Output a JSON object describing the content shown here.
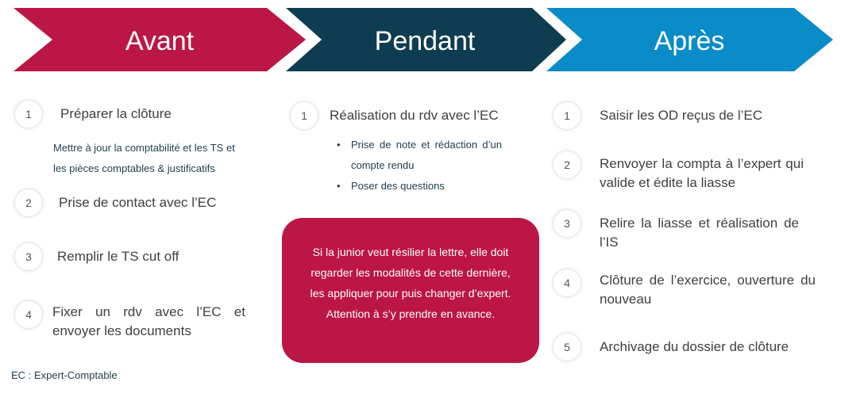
{
  "phases": [
    {
      "title": "Avant",
      "color": "#bb1645",
      "steps": [
        {
          "num": "1",
          "text": "Préparer la clôture",
          "detail_lines": [
            "Mettre à jour la comptabilité et les TS et",
            "les pièces comptables & justificatifs"
          ]
        },
        {
          "num": "2",
          "text": "Prise de contact avec l’EC"
        },
        {
          "num": "3",
          "text": "Remplir le TS cut off"
        },
        {
          "num": "4",
          "text": "Fixer un rdv avec l’EC et envoyer les documents"
        }
      ]
    },
    {
      "title": "Pendant",
      "color": "#0e3d52",
      "steps": [
        {
          "num": "1",
          "text": "Réalisation du rdv avec l’EC",
          "bullets": [
            "Prise de note et rédaction d’un compte rendu",
            "Poser des questions"
          ]
        }
      ],
      "note": "Si la junior veut résilier la lettre, elle doit regarder les modalités de cette dernière, les appliquer pour puis changer d’expert. Attention à s’y prendre en avance.",
      "note_color": "#bb1645"
    },
    {
      "title": "Après",
      "color": "#0a8cc9",
      "steps": [
        {
          "num": "1",
          "text": "Saisir les OD reçus de l’EC"
        },
        {
          "num": "2",
          "text": "Renvoyer la compta à l’expert qui valide et édite la liasse"
        },
        {
          "num": "3",
          "text": "Relire la liasse et réalisation de l’IS"
        },
        {
          "num": "4",
          "text": "Clôture de l’exercice, ouverture du nouveau"
        },
        {
          "num": "5",
          "text": "Archivage du dossier de clôture"
        }
      ]
    }
  ],
  "footnote": "EC : Expert-Comptable"
}
